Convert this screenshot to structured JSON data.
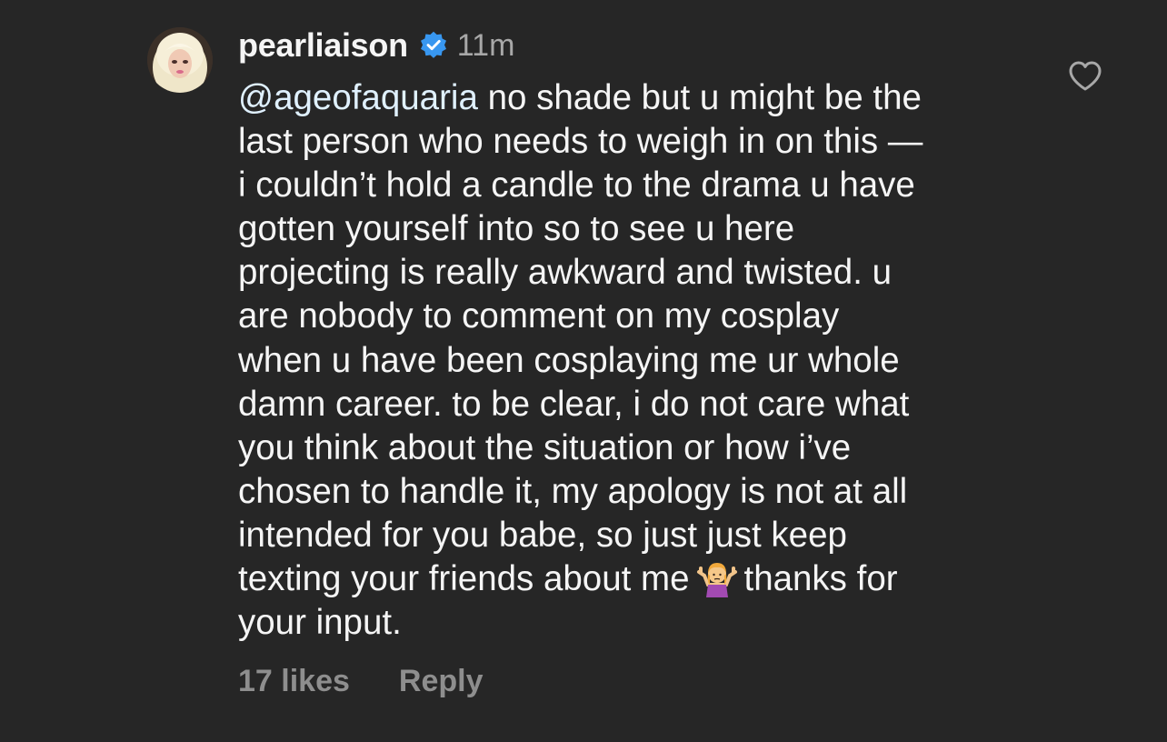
{
  "comment": {
    "username": "pearliaison",
    "time": "11m",
    "mention": "@ageofaquaria",
    "text_before_emoji": " no shade but u might be the\nlast person who needs to weigh in on this —\ni couldn’t hold a candle to the drama u have\ngotten yourself into so to see u here\nprojecting is really awkward and twisted. u\nare nobody to comment on my cosplay\nwhen u have been cosplaying me ur whole\ndamn career. to be clear, i do not care what\nyou think about the situation or how i’ve\nchosen to handle it, my apology is not at all\nintended for you babe, so just just keep\ntexting your friends about me",
    "emoji": "🤷‍♀️",
    "text_after_emoji": "thanks for\nyour input.",
    "likes": "17 likes",
    "reply_label": "Reply"
  },
  "icons": {
    "verified": "verified-badge-icon",
    "like": "heart-outline-icon",
    "emoji": "woman-shrugging-emoji"
  },
  "colors": {
    "background": "#262626",
    "text": "#f5f5f5",
    "mention": "#e0f1ff",
    "muted": "#8e8e8e",
    "time": "#a8a8a8",
    "verified": "#3897f0"
  }
}
